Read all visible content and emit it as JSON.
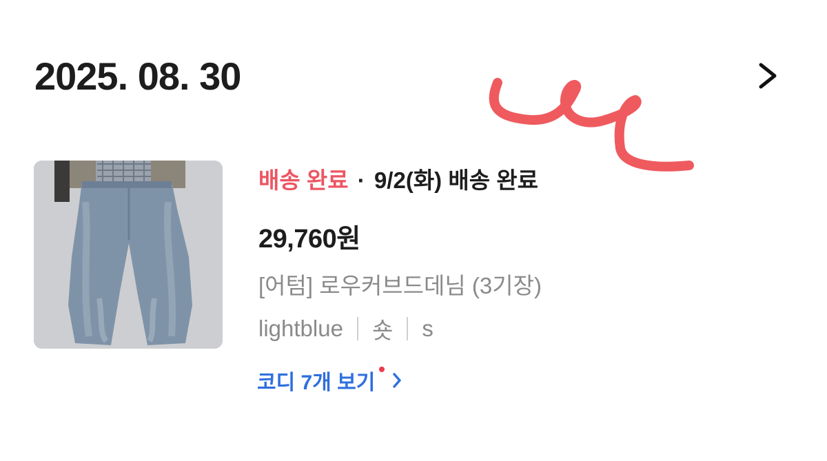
{
  "order": {
    "date": "2025. 08. 30"
  },
  "item": {
    "status_label": "배송 완료",
    "separator": "·",
    "status_detail": "9/2(화) 배송 완료",
    "price": "29,760원",
    "product_name": "[어텀] 로우커브드데님 (3기장)",
    "options": [
      "lightblue",
      "숏",
      "s"
    ]
  },
  "coordi": {
    "label": "코디 7개 보기"
  },
  "colors": {
    "status_red": "#ec5562",
    "link_blue": "#2f6fde",
    "doodle_red": "#ef5a5f"
  },
  "icons": {
    "detail_chevron": "chevron-right-icon",
    "coordi_chevron": "chevron-right-icon",
    "new_dot": "notification-dot"
  }
}
